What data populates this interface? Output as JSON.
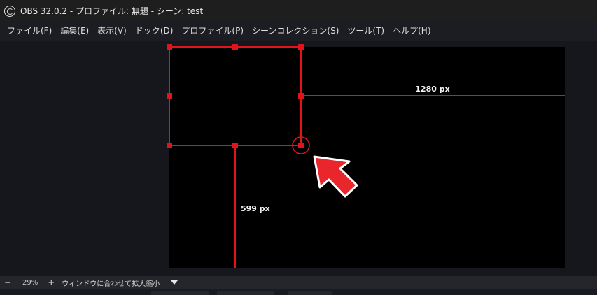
{
  "window": {
    "title": "OBS 32.0.2 - プロファイル: 無題 - シーン: test"
  },
  "menu": {
    "items": [
      "ファイル(F)",
      "編集(E)",
      "表示(V)",
      "ドック(D)",
      "プロファイル(P)",
      "シーンコレクション(S)",
      "ツール(T)",
      "ヘルプ(H)"
    ]
  },
  "preview": {
    "width_label": "1280 px",
    "height_label": "599 px",
    "accent_color": "#e2141b"
  },
  "statusbar": {
    "zoom_out": "−",
    "zoom_level": "29%",
    "zoom_in": "+",
    "scale_mode": "ウィンドウに合わせて拡大縮小"
  }
}
